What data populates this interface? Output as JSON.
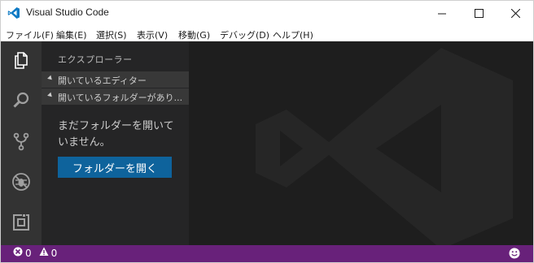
{
  "window": {
    "title": "Visual Studio Code",
    "icons": {
      "app": "vscode-logo-icon",
      "minimize": "minimize-icon",
      "maximize": "maximize-icon",
      "close": "close-icon"
    }
  },
  "menu": {
    "file": "ファイル(F)",
    "edit": "編集(E)",
    "selection": "選択(S)",
    "view": "表示(V)",
    "goto": "移動(G)",
    "debug": "デバッグ(D)",
    "help": "ヘルプ(H)"
  },
  "activitybar": {
    "items": [
      "files-icon",
      "search-icon",
      "git-branch-icon",
      "debug-icon",
      "extensions-icon"
    ]
  },
  "sidebar": {
    "title": "エクスプローラー",
    "sections": [
      "開いているエディター",
      "開いているフォルダーがあり..."
    ],
    "empty_message": "まだフォルダーを開いていません。",
    "open_folder_button": "フォルダーを開く"
  },
  "statusbar": {
    "errors": "0",
    "warnings": "0",
    "icons": {
      "errors": "error-icon",
      "warnings": "warning-icon",
      "feedback": "smiley-icon"
    }
  },
  "colors": {
    "accent": "#007acc",
    "statusbar": "#68217a",
    "button": "#0e639c",
    "activitybar": "#333333",
    "sidebar": "#252526",
    "editor": "#1e1e1e"
  }
}
